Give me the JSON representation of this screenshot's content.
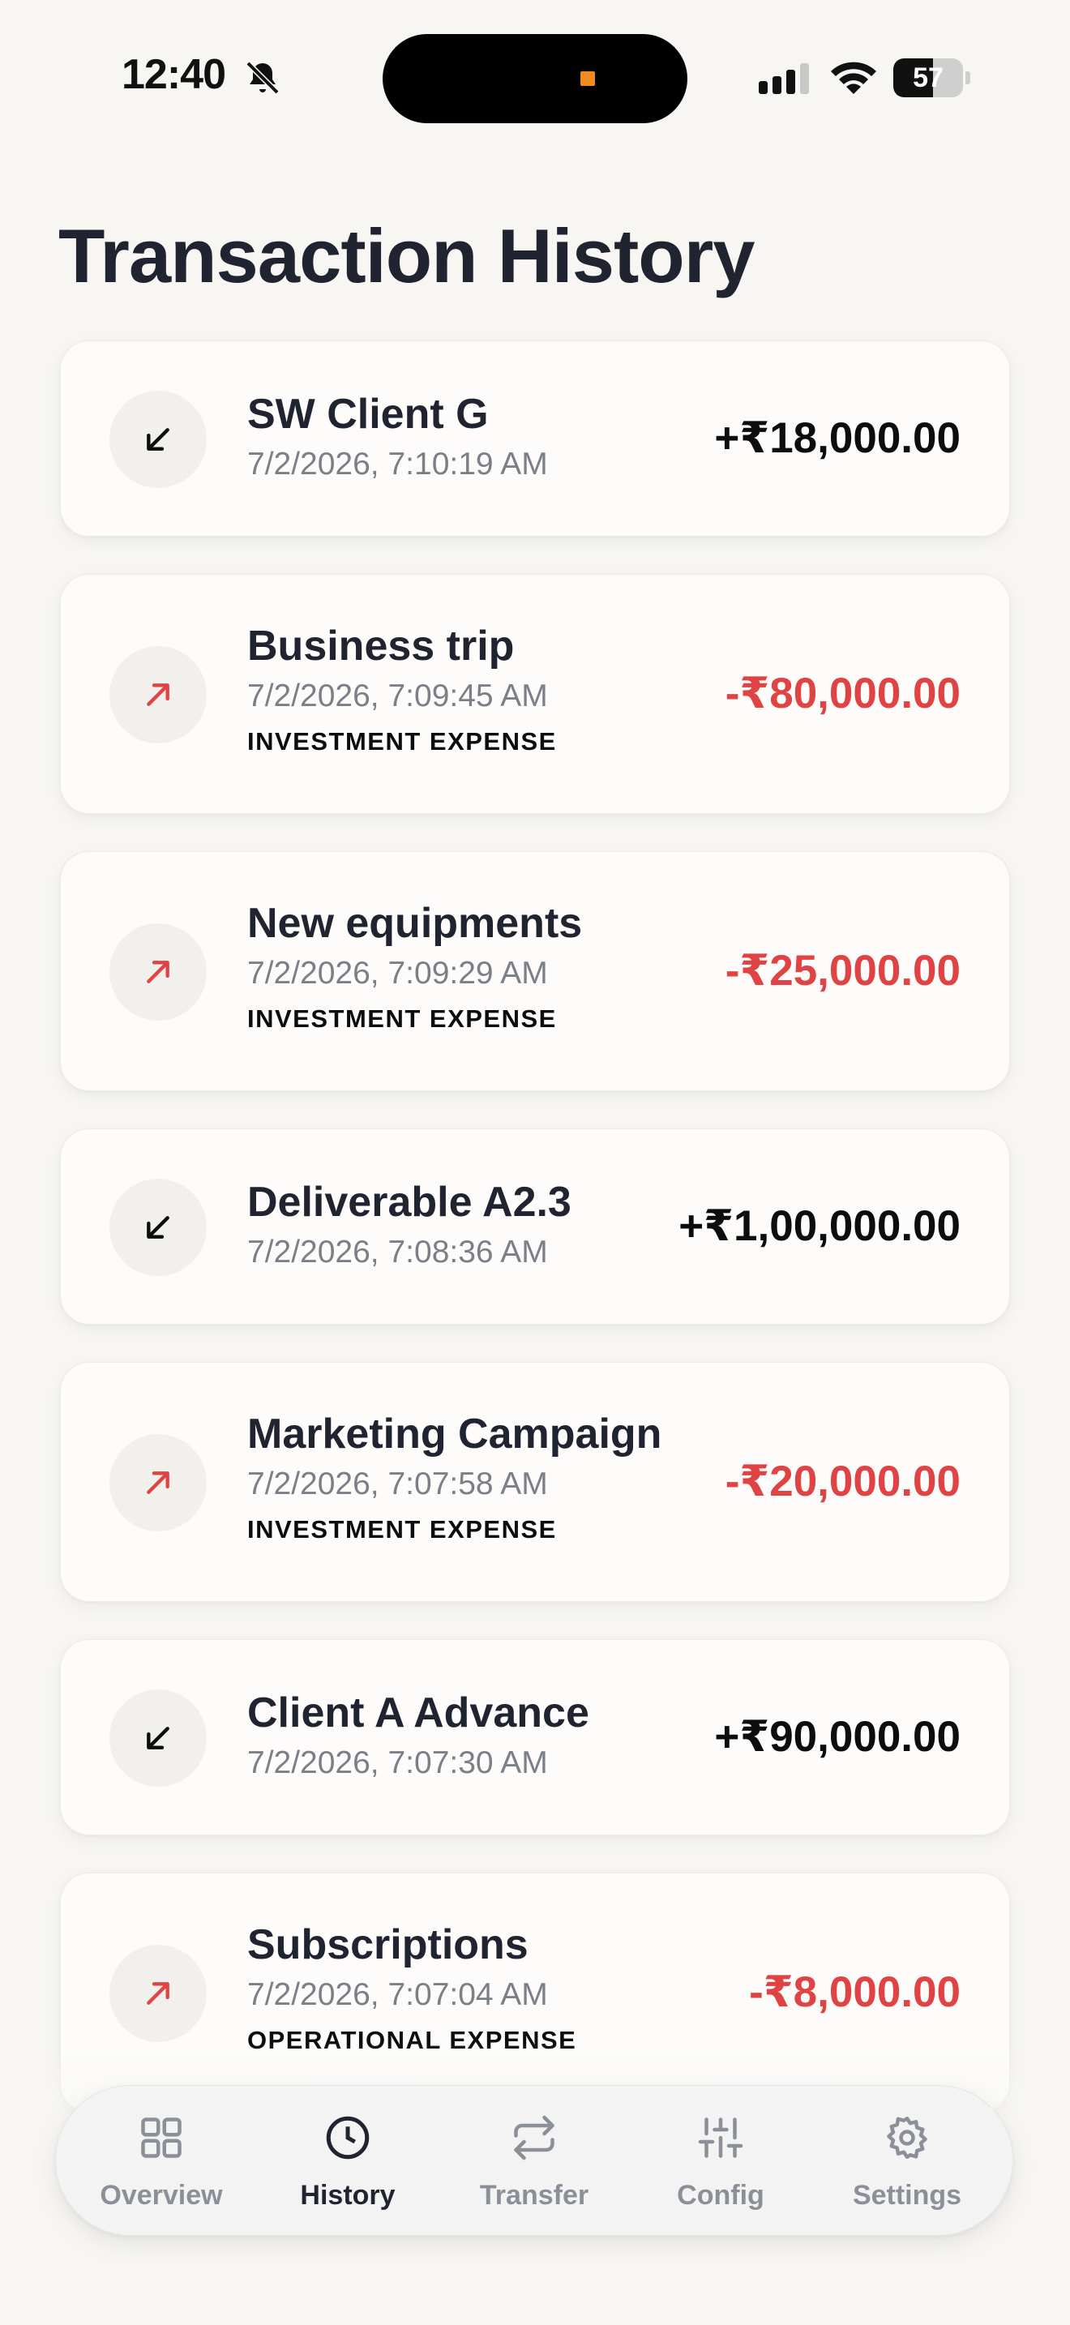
{
  "status_bar": {
    "time": "12:40",
    "battery": "57",
    "battery_level": 0.57,
    "icons": [
      "bell-slash-icon",
      "signal-icon",
      "wifi-icon",
      "battery-icon"
    ]
  },
  "page": {
    "title": "Transaction History"
  },
  "colors": {
    "credit": "#0d0d0d",
    "debit": "#df4343",
    "accent": "#1f2430"
  },
  "transactions": [
    {
      "title": "SW Client G",
      "date": "7/2/2026, 7:10:19 AM",
      "category": "",
      "amount": "+₹18,000.00",
      "direction": "in"
    },
    {
      "title": "Business trip",
      "date": "7/2/2026, 7:09:45 AM",
      "category": "INVESTMENT EXPENSE",
      "amount": "-₹80,000.00",
      "direction": "out"
    },
    {
      "title": "New equipments",
      "date": "7/2/2026, 7:09:29 AM",
      "category": "INVESTMENT EXPENSE",
      "amount": "-₹25,000.00",
      "direction": "out"
    },
    {
      "title": "Deliverable A2.3",
      "date": "7/2/2026, 7:08:36 AM",
      "category": "",
      "amount": "+₹1,00,000.00",
      "direction": "in"
    },
    {
      "title": "Marketing Campaign",
      "date": "7/2/2026, 7:07:58 AM",
      "category": "INVESTMENT EXPENSE",
      "amount": "-₹20,000.00",
      "direction": "out"
    },
    {
      "title": "Client A Advance",
      "date": "7/2/2026, 7:07:30 AM",
      "category": "",
      "amount": "+₹90,000.00",
      "direction": "in"
    },
    {
      "title": "Subscriptions",
      "date": "7/2/2026, 7:07:04 AM",
      "category": "OPERATIONAL EXPENSE",
      "amount": "-₹8,000.00",
      "direction": "out"
    }
  ],
  "tabbar": {
    "tabs": [
      {
        "label": "Overview",
        "icon": "grid-icon",
        "active": false
      },
      {
        "label": "History",
        "icon": "clock-icon",
        "active": true
      },
      {
        "label": "Transfer",
        "icon": "transfer-icon",
        "active": false
      },
      {
        "label": "Config",
        "icon": "sliders-icon",
        "active": false
      },
      {
        "label": "Settings",
        "icon": "gear-icon",
        "active": false
      }
    ]
  }
}
